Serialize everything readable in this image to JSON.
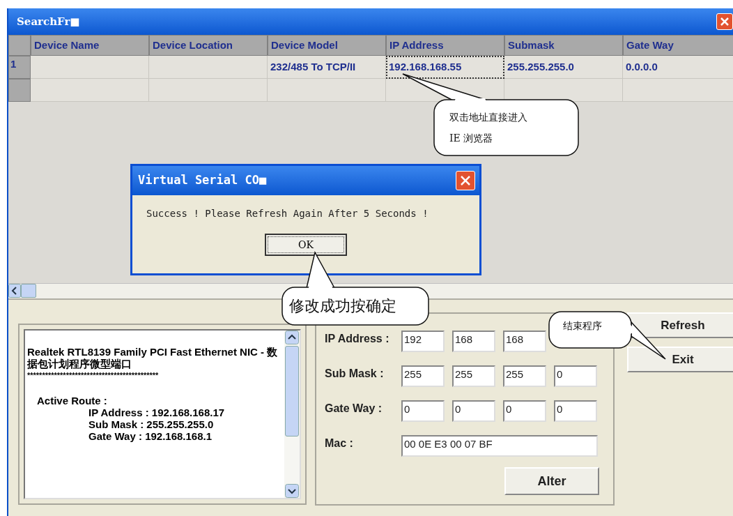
{
  "window": {
    "title": "SearchFr■"
  },
  "table": {
    "columns": [
      "Device Name",
      "Device Location",
      "Device Model",
      "IP Address",
      "Submask",
      "Gate Way"
    ],
    "rows": [
      {
        "header": "1",
        "cells": [
          null,
          null,
          {
            "text": "232/485 To TCP/II",
            "focused": false
          },
          {
            "text": "192.168.168.55",
            "focused": true
          },
          {
            "text": "255.255.255.0",
            "focused": false
          },
          {
            "text": "0.0.0.0",
            "focused": false
          }
        ]
      },
      {}
    ]
  },
  "dialog": {
    "title": "Virtual Serial CO■",
    "message": "Success ! Please Refresh Again After 5 Seconds !",
    "button": "OK"
  },
  "info_box": {
    "lines": [
      {
        "kind": "heading",
        "text": "Realtek RTL8139 Family PCI Fast Ethernet NIC - 数据包计划程序微型端口"
      },
      {
        "kind": "separator",
        "text": "********************************************"
      },
      {
        "kind": "label",
        "text": "Active Route :"
      },
      {
        "kind": "value",
        "text": "IP Address : 192.168.168.17"
      },
      {
        "kind": "value",
        "text": "Sub Mask : 255.255.255.0"
      },
      {
        "kind": "value",
        "text": "Gate Way : 192.168.168.1"
      }
    ]
  },
  "form": {
    "rows": [
      {
        "label": "IP Address :",
        "fields": [
          "192",
          "168",
          "168"
        ]
      },
      {
        "label": "Sub Mask :",
        "fields": [
          "255",
          "255",
          "255",
          "0"
        ]
      },
      {
        "label": "Gate Way :",
        "fields": [
          "0",
          "0",
          "0",
          "0"
        ]
      }
    ],
    "mac": {
      "label": "Mac :",
      "value": "00 0E E3 00 07 BF"
    },
    "alter_button": "Alter"
  },
  "buttons": [
    "Refresh",
    "Exit"
  ],
  "callouts": [
    {
      "text": "双击地址直接进入IE 浏览器"
    },
    {
      "text": "修改成功按确定"
    },
    {
      "text": "结束程序"
    }
  ]
}
